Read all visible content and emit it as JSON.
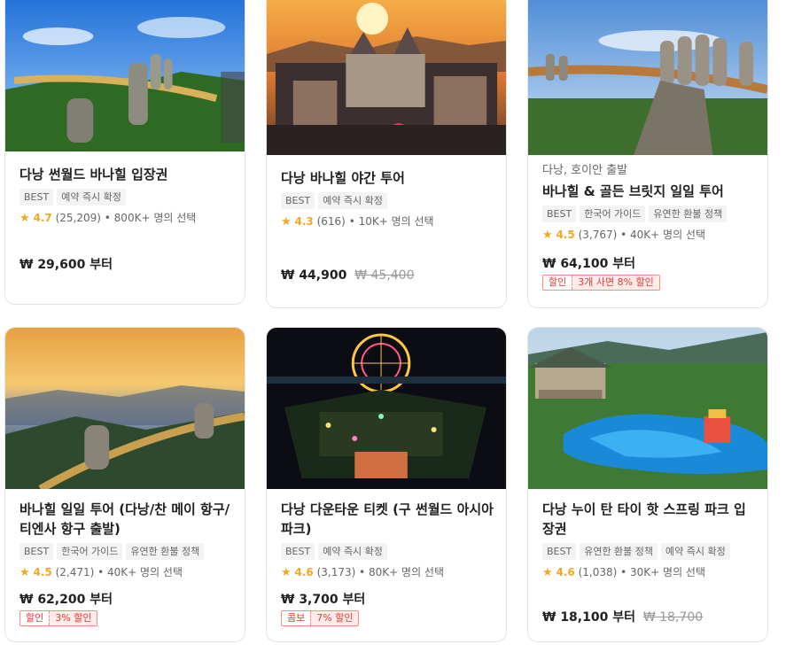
{
  "cards": [
    {
      "title": "다낭 썬월드 바나힐 입장권",
      "origin": "",
      "badges": [
        "BEST",
        "예약 즉시 확정"
      ],
      "rating": "4.7",
      "reviews": "(25,209)",
      "popularity": "800K+ 명의 선택",
      "price": "₩ 29,600 부터",
      "original_price": "",
      "promo_tag": "",
      "promo_text": ""
    },
    {
      "title": "다낭 바나힐 야간 투어",
      "origin": "",
      "badges": [
        "BEST",
        "예약 즉시 확정"
      ],
      "rating": "4.3",
      "reviews": "(616)",
      "popularity": "10K+ 명의 선택",
      "price": "₩ 44,900",
      "original_price": "₩ 45,400",
      "promo_tag": "",
      "promo_text": ""
    },
    {
      "title": "바나힐 & 골든 브릿지 일일 투어",
      "origin": "다낭, 호이안 출발",
      "badges": [
        "BEST",
        "한국어 가이드",
        "유연한 환불 정책"
      ],
      "rating": "4.5",
      "reviews": "(3,767)",
      "popularity": "40K+ 명의 선택",
      "price": "₩ 64,100 부터",
      "original_price": "",
      "promo_tag": "할인",
      "promo_text": "3개 사면 8% 할인"
    },
    {
      "title": "바나힐 일일 투어 (다낭/찬 메이 항구/티엔사 항구 출발)",
      "origin": "",
      "badges": [
        "BEST",
        "한국어 가이드",
        "유연한 환불 정책"
      ],
      "rating": "4.5",
      "reviews": "(2,471)",
      "popularity": "40K+ 명의 선택",
      "price": "₩ 62,200 부터",
      "original_price": "",
      "promo_tag": "할인",
      "promo_text": "3% 할인"
    },
    {
      "title": "다낭 다운타운 티켓 (구 썬월드 아시아 파크)",
      "origin": "",
      "badges": [
        "BEST",
        "예약 즉시 확정"
      ],
      "rating": "4.6",
      "reviews": "(3,173)",
      "popularity": "80K+ 명의 선택",
      "price": "₩ 3,700 부터",
      "original_price": "",
      "promo_tag": "콤보",
      "promo_text": "7% 할인"
    },
    {
      "title": "다낭 누이 탄 타이 핫 스프링 파크 입장권",
      "origin": "",
      "badges": [
        "BEST",
        "유연한 환불 정책",
        "예약 즉시 확정"
      ],
      "rating": "4.6",
      "reviews": "(1,038)",
      "popularity": "30K+ 명의 선택",
      "price": "₩ 18,100 부터",
      "original_price": "₩ 18,700",
      "promo_tag": "",
      "promo_text": ""
    }
  ],
  "separator": "•",
  "star_icon": "star-icon",
  "accent_color": "#f5a623",
  "promo_color": "#e53935"
}
